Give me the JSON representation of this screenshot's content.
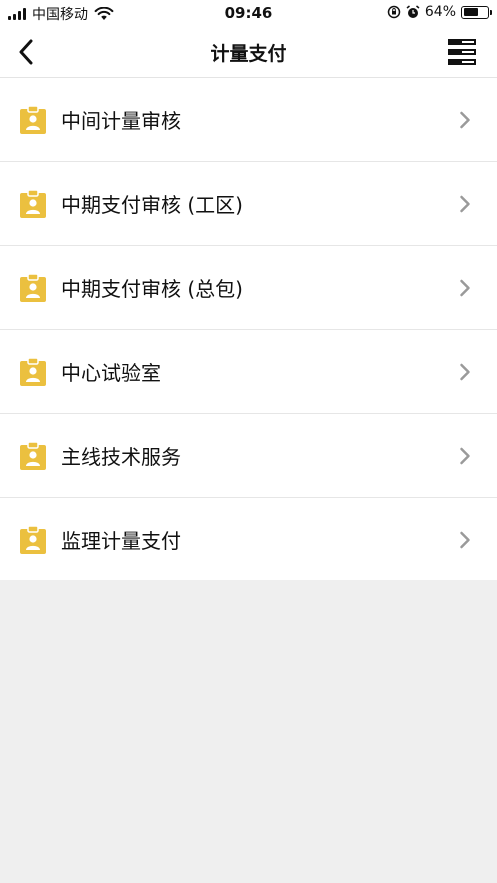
{
  "status_bar": {
    "carrier": "中国移动",
    "time": "09:46",
    "battery_percent": "64%",
    "battery_level": 0.64,
    "icons": [
      "signal-icon",
      "wifi-icon",
      "orientation-lock-icon",
      "alarm-icon",
      "battery-icon"
    ]
  },
  "nav": {
    "title": "计量支付",
    "back_icon": "chevron-left-icon",
    "menu_icon": "list-menu-icon"
  },
  "list": {
    "items": [
      {
        "label": "中间计量审核",
        "icon": "clipboard-user-icon"
      },
      {
        "label": "中期支付审核 (工区)",
        "icon": "clipboard-user-icon"
      },
      {
        "label": "中期支付审核 (总包)",
        "icon": "clipboard-user-icon"
      },
      {
        "label": "中心试验室",
        "icon": "clipboard-user-icon"
      },
      {
        "label": "主线技术服务",
        "icon": "clipboard-user-icon"
      },
      {
        "label": "监理计量支付",
        "icon": "clipboard-user-icon"
      }
    ]
  },
  "colors": {
    "icon_accent": "#EBC03F",
    "chevron": "#9a9a9a",
    "background": "#efefef"
  }
}
